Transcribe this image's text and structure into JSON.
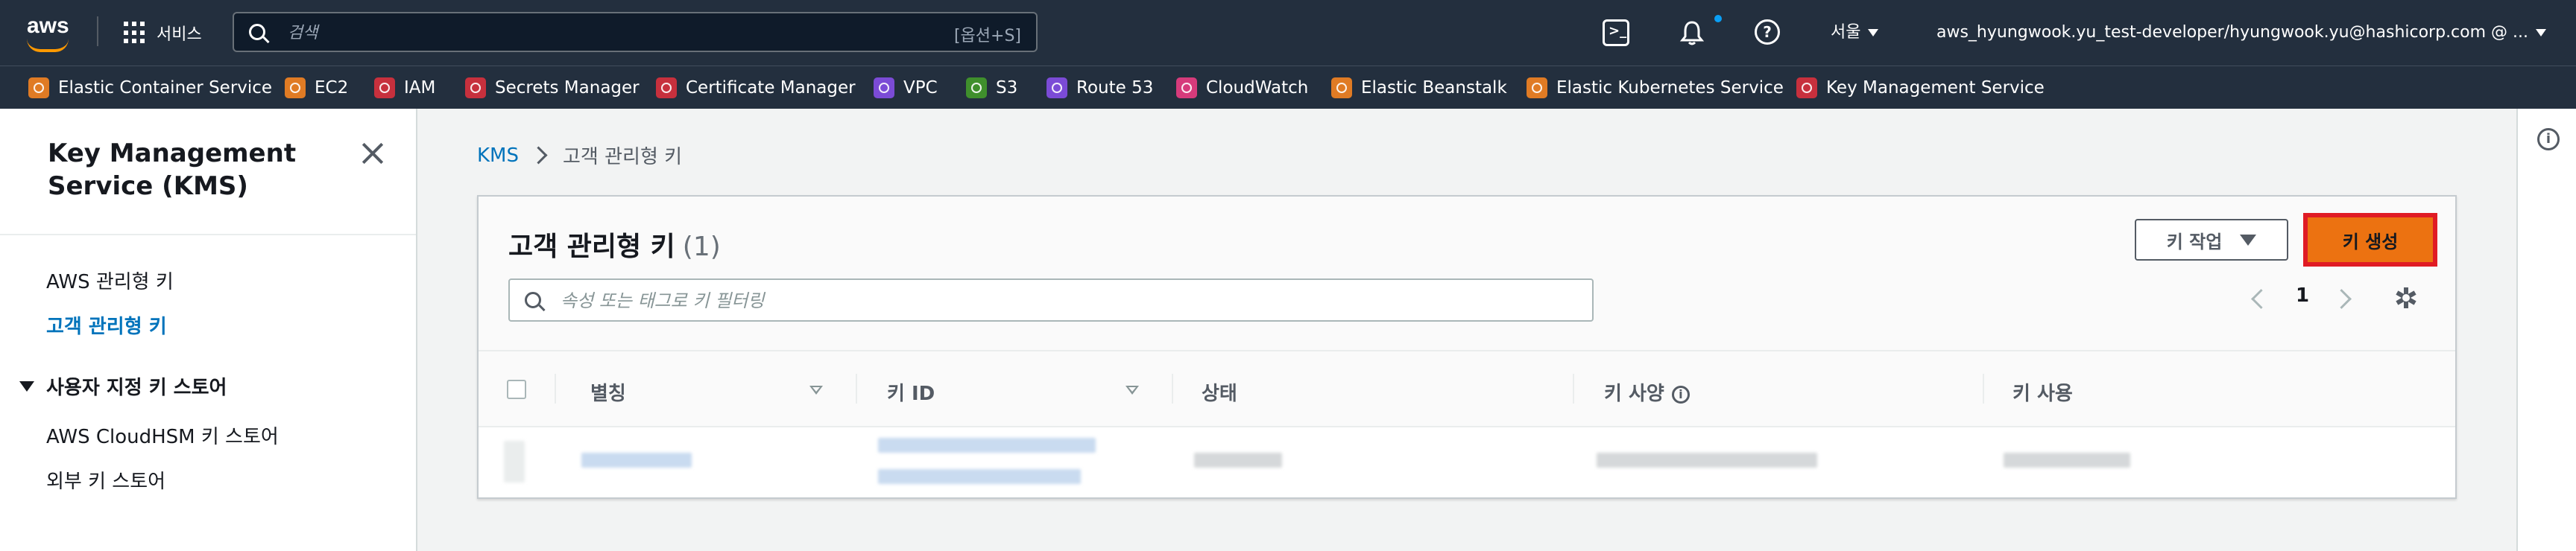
{
  "topnav": {
    "logo": "aws",
    "services_label": "서비스",
    "search_placeholder": "검색",
    "search_shortcut": "[옵션+S]",
    "region": "서울",
    "account": "aws_hyungwook.yu_test-developer/hyungwook.yu@hashicorp.com @ ...",
    "notification_dot_color": "#0a9ff5"
  },
  "favorites": [
    {
      "label": "Elastic Container Service",
      "color": "#e07b24"
    },
    {
      "label": "EC2",
      "color": "#e07b24"
    },
    {
      "label": "IAM",
      "color": "#c7303d"
    },
    {
      "label": "Secrets Manager",
      "color": "#c7303d"
    },
    {
      "label": "Certificate Manager",
      "color": "#c7303d"
    },
    {
      "label": "VPC",
      "color": "#7b4bd6"
    },
    {
      "label": "S3",
      "color": "#3f8f2c"
    },
    {
      "label": "Route 53",
      "color": "#7b4bd6"
    },
    {
      "label": "CloudWatch",
      "color": "#d63b7b"
    },
    {
      "label": "Elastic Beanstalk",
      "color": "#e07b24"
    },
    {
      "label": "Elastic Kubernetes Service",
      "color": "#e07b24"
    },
    {
      "label": "Key Management Service",
      "color": "#c7303d"
    }
  ],
  "sidebar": {
    "title": "Key Management Service (KMS)",
    "items": [
      {
        "label": "AWS 관리형 키"
      },
      {
        "label": "고객 관리형 키"
      }
    ],
    "section": {
      "label": "사용자 지정 키 스토어",
      "items": [
        {
          "label": "AWS CloudHSM 키 스토어"
        },
        {
          "label": "외부 키 스토어"
        }
      ]
    }
  },
  "breadcrumb": {
    "root": "KMS",
    "current": "고객 관리형 키"
  },
  "panel": {
    "title": "고객 관리형 키",
    "count": "(1)",
    "actions_label": "키 작업",
    "create_label": "키 생성",
    "filter_placeholder": "속성 또는 태그로 키 필터링",
    "page_number": "1",
    "columns": [
      "별칭",
      "키 ID",
      "상태",
      "키 사양",
      "키 사용"
    ]
  },
  "colors": {
    "primary_button": "#ec7211",
    "highlight_border": "#e01b24",
    "link": "#0073bb",
    "nav_bg": "#232f3e"
  }
}
